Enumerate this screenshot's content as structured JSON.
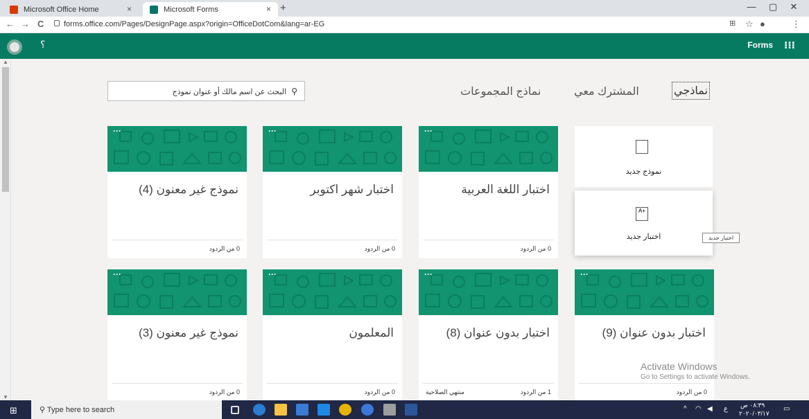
{
  "browser": {
    "tabs": [
      {
        "label": "Microsoft Office Home",
        "close": "×"
      },
      {
        "label": "Microsoft Forms",
        "close": "×"
      }
    ],
    "new_tab": "+",
    "window_controls": {
      "minimize": "—",
      "restore": "▢",
      "close": "✕"
    },
    "url": "forms.office.com/Pages/DesignPage.aspx?origin=OfficeDotCom&lang=ar-EG",
    "nav": {
      "back": "←",
      "forward": "→",
      "reload": "C"
    },
    "right_icons": {
      "star": "☆",
      "profile": "●",
      "menu": "⋮"
    }
  },
  "forms_header": {
    "help": "؟",
    "brand": "Forms",
    "apps": "⁝⁝⁝",
    "color": "#067b62"
  },
  "search": {
    "placeholder": "البحث عن اسم مالك أو عنوان نموذج"
  },
  "nav_tabs": [
    {
      "label": "نماذجي",
      "selected": true
    },
    {
      "label": "المشترك معي",
      "selected": false
    },
    {
      "label": "نماذج المجموعات",
      "selected": false
    }
  ],
  "new_items": {
    "new_form": "نموذج جديد",
    "new_quiz": "اختبار جديد",
    "tooltip": "اختبار جديد"
  },
  "cards": [
    {
      "title": "اختبار اللغة العربية",
      "responses": "0 من الردود",
      "extra": "",
      "more": "···"
    },
    {
      "title": "اختبار شهر اكتوبر",
      "responses": "0 من الردود",
      "extra": "",
      "more": "···"
    },
    {
      "title": "نموذج غير معنون (4)",
      "responses": "0 من الردود",
      "extra": "",
      "more": "···"
    },
    {
      "title": "اختبار بدون عنوان (9)",
      "responses": "0 من الردود",
      "extra": "",
      "more": "···"
    },
    {
      "title": "اختبار بدون عنوان (8)",
      "responses": "1 من الردود",
      "extra": "منتهي الصلاحية",
      "more": "···"
    },
    {
      "title": "المعلمون",
      "responses": "0 من الردود",
      "extra": "",
      "more": "···"
    },
    {
      "title": "نموذج غير معنون (3)",
      "responses": "0 من الردود",
      "extra": "",
      "more": "···"
    }
  ],
  "watermark": {
    "line1": "Activate Windows",
    "line2": "Go to Settings to activate Windows."
  },
  "taskbar": {
    "search_placeholder": "Type here to search",
    "clock_time": "٠٨:٣٩ ص",
    "clock_date": "٢٠٢٠/٠٣/١٧",
    "lang": "ع"
  }
}
